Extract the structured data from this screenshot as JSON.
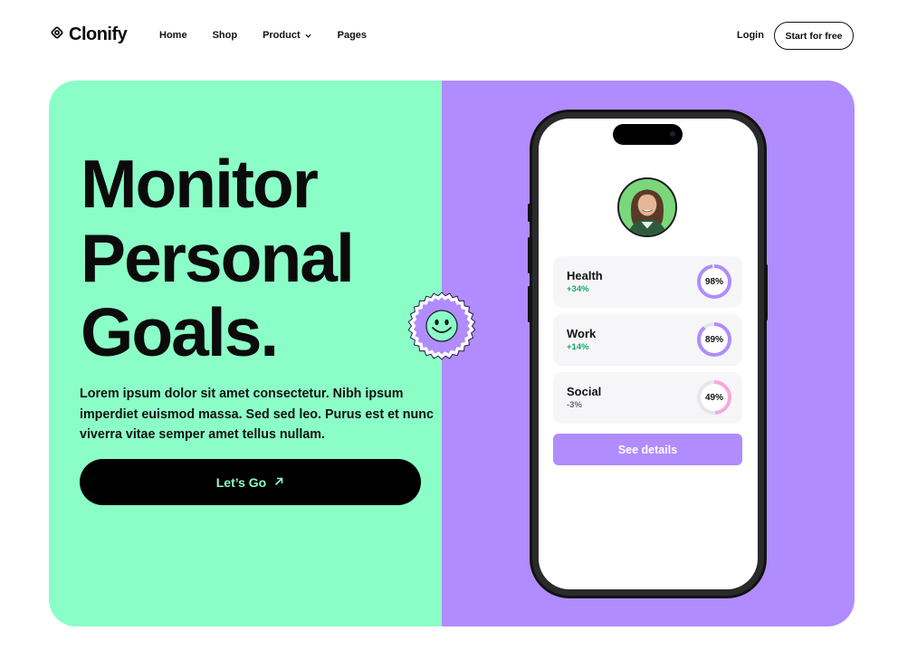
{
  "brand": {
    "name": "Clonify",
    "icon": "flower-logo-icon"
  },
  "nav": {
    "links": [
      {
        "label": "Home"
      },
      {
        "label": "Shop"
      },
      {
        "label": "Product",
        "has_dropdown": true
      },
      {
        "label": "Pages"
      }
    ],
    "login_label": "Login",
    "cta_label": "Start for free"
  },
  "hero": {
    "headline": [
      "Monitor",
      "Personal",
      "Goals."
    ],
    "description": "Lorem ipsum dolor sit amet consectetur. Nibh ipsum imperdiet euismod massa. Sed sed leo. Purus est et nunc viverra vitae semper amet tellus nullam.",
    "button_label": "Let’s Go",
    "button_icon": "arrow-up-right-icon",
    "sticker_icon": "smiley-face-icon",
    "colors": {
      "left_bg": "#8bfec8",
      "right_bg": "#b08cff",
      "button_bg": "#000000",
      "button_text": "#8bfec8"
    }
  },
  "phone": {
    "goals": [
      {
        "title": "Health",
        "change": "+34%",
        "percent_label": "98%",
        "percent": 98,
        "change_color": "#18a86b",
        "ring_color": "#b08cff"
      },
      {
        "title": "Work",
        "change": "+14%",
        "percent_label": "89%",
        "percent": 89,
        "change_color": "#18a86b",
        "ring_color": "#b08cff"
      },
      {
        "title": "Social",
        "change": "-3%",
        "percent_label": "49%",
        "percent": 49,
        "change_color": "#6b6b6b",
        "ring_color": "#f7a8dd"
      }
    ],
    "details_label": "See details"
  }
}
